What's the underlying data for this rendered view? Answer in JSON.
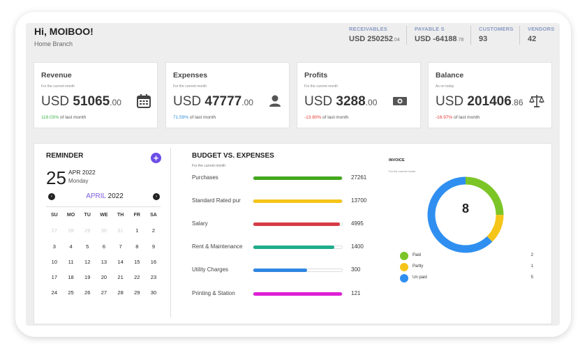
{
  "header": {
    "greeting": "Hi, MOIBOO!",
    "branch": "Home Branch",
    "stats": [
      {
        "label": "RECEIVABLES",
        "currency": "USD",
        "amount": "250252",
        "cents": ".04"
      },
      {
        "label": "PAYABLE S",
        "currency": "USD",
        "amount": "-64188",
        "cents": ".78"
      },
      {
        "label": "CUSTOMERS",
        "currency": "",
        "amount": "93",
        "cents": ""
      },
      {
        "label": "VENDORS",
        "currency": "",
        "amount": "42",
        "cents": ""
      }
    ]
  },
  "cards": [
    {
      "title": "Revenue",
      "sub": "For the current month",
      "currency": "USD",
      "amount": "51065",
      "cents": ".00",
      "change": "119.03%",
      "change_text": "of last month",
      "icon": "calendar-icon"
    },
    {
      "title": "Expenses",
      "sub": "For the current month",
      "currency": "USD",
      "amount": "47777",
      "cents": ".00",
      "change": "71.59%",
      "change_text": "of last month",
      "icon": "user-icon"
    },
    {
      "title": "Profits",
      "sub": "For the current month",
      "currency": "USD",
      "amount": "3288",
      "cents": ".00",
      "change": "-13.80%",
      "change_text": "of last month",
      "icon": "cash-icon"
    },
    {
      "title": "Balance",
      "sub": "As on today",
      "currency": "USD",
      "amount": "201406",
      "cents": ".86",
      "change": "-16.97%",
      "change_text": "of last month",
      "icon": "scale-icon"
    }
  ],
  "reminder": {
    "title": "REMINDER",
    "add_label": "+",
    "day": "25",
    "month_year": "APR 2022",
    "weekday": "Monday",
    "cal_month": "APRIL",
    "cal_year": "2022",
    "prev_label": "‹",
    "next_label": "›",
    "weekdays": [
      "SU",
      "MO",
      "TU",
      "WE",
      "TH",
      "FR",
      "SA"
    ],
    "weeks": [
      [
        "27",
        "28",
        "29",
        "30",
        "31",
        "1",
        "2"
      ],
      [
        "3",
        "4",
        "5",
        "6",
        "7",
        "8",
        "9"
      ],
      [
        "10",
        "11",
        "12",
        "13",
        "14",
        "15",
        "16"
      ],
      [
        "17",
        "18",
        "19",
        "20",
        "21",
        "22",
        "23"
      ],
      [
        "24",
        "25",
        "26",
        "27",
        "28",
        "29",
        "30"
      ]
    ]
  },
  "budget": {
    "title": "BUDGET VS. EXPENSES",
    "sub": "For the current month",
    "items": [
      {
        "name": "Purchases",
        "value": "27261",
        "fill": 1.0,
        "color": "#43a81e"
      },
      {
        "name": "Standard Rated pur",
        "value": "13700",
        "fill": 1.0,
        "color": "#f5c518"
      },
      {
        "name": "Salary",
        "value": "4995",
        "fill": 0.98,
        "color": "#d63b45"
      },
      {
        "name": "Rent & Maintenance",
        "value": "1400",
        "fill": 0.91,
        "color": "#1fad8c"
      },
      {
        "name": "Utility Charges",
        "value": "300",
        "fill": 0.61,
        "color": "#2f86e0"
      },
      {
        "name": "Printing & Station",
        "value": "121",
        "fill": 1.0,
        "color": "#de1fd6"
      }
    ]
  },
  "invoice": {
    "title": "INVOICE",
    "sub": "For the current month",
    "total": "8",
    "items": [
      {
        "name": "Paid",
        "value": "2",
        "color": "#7cc527"
      },
      {
        "name": "Partly",
        "value": "1",
        "color": "#f5c518"
      },
      {
        "name": "Un paid",
        "value": "5",
        "color": "#2f8ff0"
      }
    ]
  }
}
